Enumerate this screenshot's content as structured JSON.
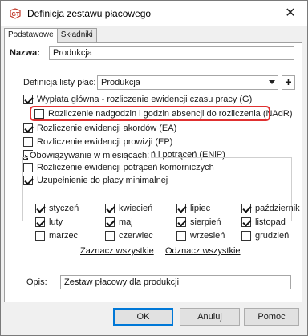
{
  "window": {
    "title": "Definicja zestawu płacowego",
    "close_glyph": "✕"
  },
  "tabs": [
    {
      "label": "Podstawowe",
      "active": true
    },
    {
      "label": "Składniki",
      "active": false
    }
  ],
  "form": {
    "name_label": "Nazwa:",
    "name_value": "Produkcja",
    "list_label": "Definicja listy płac:",
    "list_value": "Produkcja",
    "plus_label": "+"
  },
  "options": [
    {
      "label": "Wypłata główna - rozliczenie ewidencji czasu pracy (G)",
      "checked": true
    },
    {
      "label": "Rozliczenie nadgodzin i godzin absencji do rozliczenia (NAdR)",
      "checked": false
    },
    {
      "label": "Rozliczenie ewidencji akordów (EA)",
      "checked": true
    },
    {
      "label": "Rozliczenie ewidencji prowizji (EP)",
      "checked": false
    },
    {
      "label": "Rozliczenie ewidencji naliczeń i potrąceń (ENiP)",
      "checked": true
    },
    {
      "label": "Rozliczenie ewidencji potrąceń komorniczych",
      "checked": false
    },
    {
      "label": "Uzupełnienie do płacy minimalnej",
      "checked": true
    }
  ],
  "months_group": {
    "title": "Obowiązywanie w miesiącach:",
    "months": [
      {
        "label": "styczeń",
        "checked": true
      },
      {
        "label": "kwiecień",
        "checked": true
      },
      {
        "label": "lipiec",
        "checked": true
      },
      {
        "label": "październik",
        "checked": true
      },
      {
        "label": "luty",
        "checked": true
      },
      {
        "label": "maj",
        "checked": true
      },
      {
        "label": "sierpień",
        "checked": true
      },
      {
        "label": "listopad",
        "checked": true
      },
      {
        "label": "marzec",
        "checked": false
      },
      {
        "label": "czerwiec",
        "checked": false
      },
      {
        "label": "wrzesień",
        "checked": false
      },
      {
        "label": "grudzień",
        "checked": false
      }
    ],
    "select_all": "Zaznacz wszystkie",
    "deselect_all": "Odznacz wszystkie"
  },
  "description": {
    "label": "Opis:",
    "value": "Zestaw płacowy dla produkcji"
  },
  "buttons": {
    "ok": "OK",
    "cancel": "Anuluj",
    "help": "Pomoc"
  },
  "colors": {
    "highlight": "#e03030",
    "accent": "#0078d7"
  }
}
